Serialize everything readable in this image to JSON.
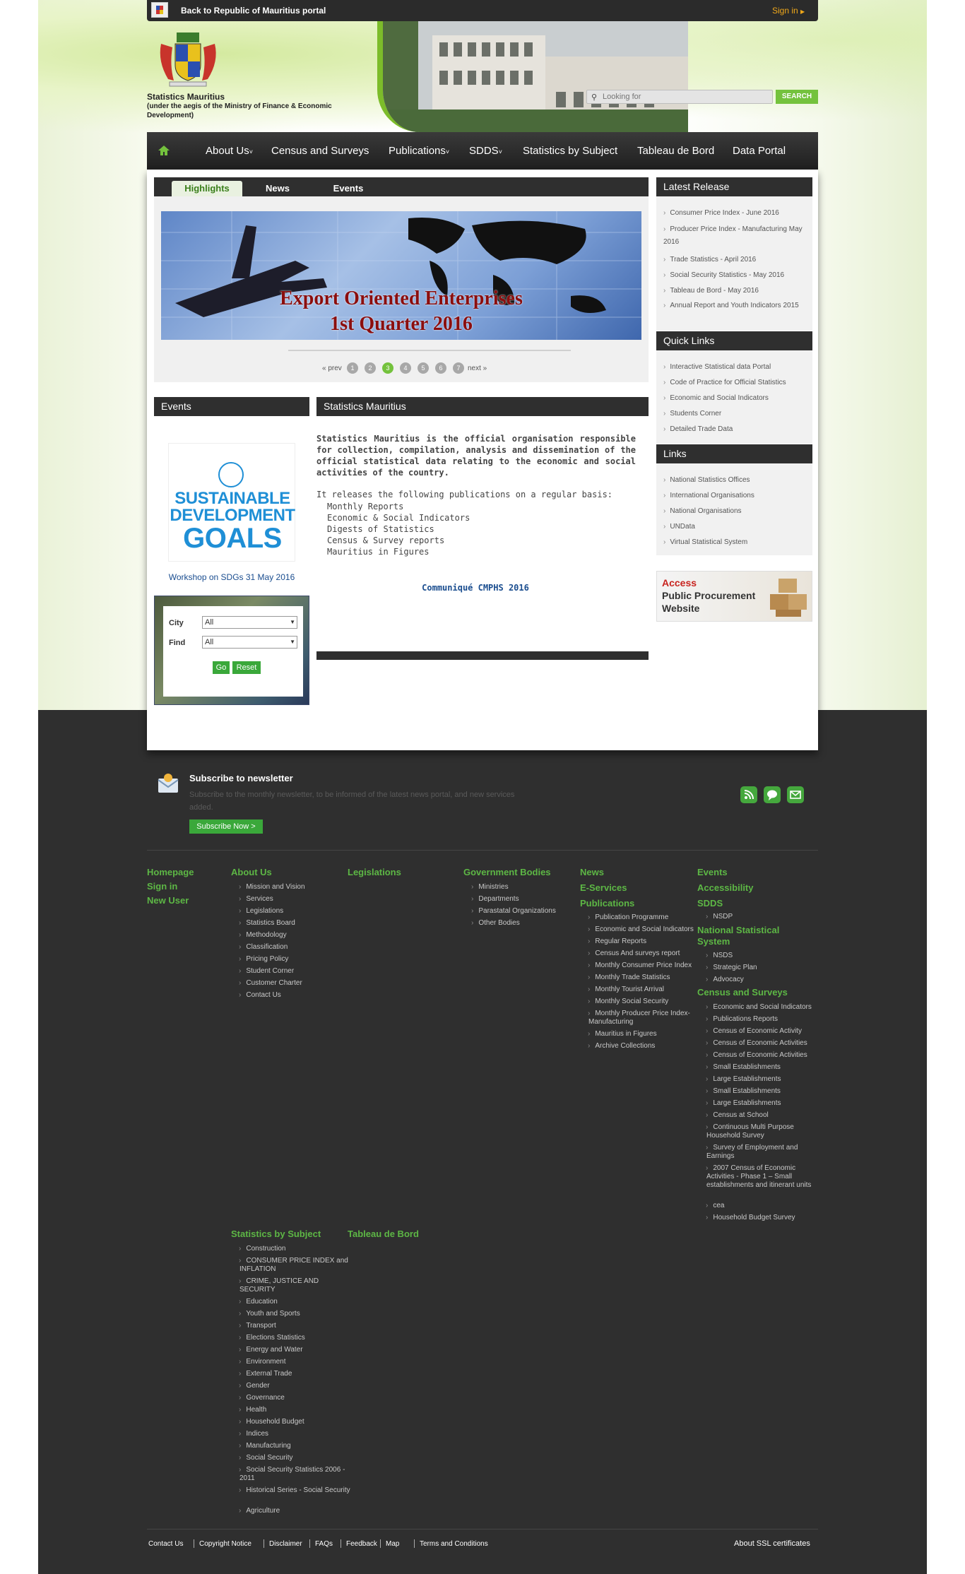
{
  "topbar": {
    "back_link": "Back to Republic of Mauritius portal",
    "signin": "Sign in"
  },
  "header": {
    "org_name": "Statistics Mauritius",
    "org_sub": "(under the aegis of the Ministry of Finance & Economic Development)",
    "search_placeholder": "Looking for",
    "search_button": "SEARCH"
  },
  "nav": [
    "About Us",
    "Census and Surveys",
    "Publications",
    "SDDS",
    "Statistics by Subject",
    "Tableau de Bord",
    "Data Portal"
  ],
  "tabs": {
    "highlights": "Highlights",
    "news": "News",
    "events": "Events"
  },
  "banner": {
    "line1": "Export Oriented Enterprises",
    "line2": "1st Quarter 2016"
  },
  "pager": {
    "prev": "« prev",
    "next": "next »",
    "pages": [
      "1",
      "2",
      "3",
      "4",
      "5",
      "6",
      "7"
    ],
    "current": "3"
  },
  "events_panel": {
    "title": "Events",
    "sdg_line1": "SUSTAINABLE",
    "sdg_line2": "DEVELOPMENT",
    "sdg_line3": "GOALS",
    "caption": "Workshop on SDGs 31 May 2016"
  },
  "finder": {
    "city_label": "City",
    "find_label": "Find",
    "city_value": "All",
    "find_value": "All",
    "go": "Go",
    "reset": "Reset"
  },
  "about": {
    "title": "Statistics Mauritius",
    "bold_lead": "Statistics Mauritius",
    "intro": "is the official organisation responsible for collection, compilation, analysis and dissemination of the official statistical data relating to the economic and social activities of the country.",
    "pubs_intro": "It releases the following publications on a regular basis:",
    "pubs": [
      "Monthly Reports",
      "Economic & Social Indicators",
      "Digests of Statistics",
      "Census & Survey reports",
      "Mauritius in Figures"
    ],
    "communique": "Communiqué CMPHS 2016"
  },
  "latest": {
    "title": "Latest Release",
    "items": [
      "Consumer Price Index - June 2016",
      "Producer Price Index - Manufacturing May 2016",
      "Trade Statistics - April 2016",
      "Social Security Statistics - May 2016",
      "Tableau de Bord - May 2016",
      "Annual Report and Youth Indicators 2015"
    ]
  },
  "quick": {
    "title": "Quick Links",
    "items": [
      "Interactive Statistical data Portal",
      "Code of Practice for Official Statistics",
      "Economic and Social Indicators",
      "Students Corner",
      "Detailed Trade Data"
    ]
  },
  "links": {
    "title": "Links",
    "items": [
      "National Statistics Offices",
      "International Organisations",
      "National Organisations",
      "UNData",
      "Virtual Statistical System"
    ]
  },
  "procurement": {
    "word1": "Access",
    "word2": "Public Procurement",
    "word3": "Website"
  },
  "newsletter": {
    "title": "Subscribe to newsletter",
    "text": "Subscribe to the monthly newsletter, to be informed of the latest news portal, and new services added.",
    "button": "Subscribe Now >"
  },
  "footer": {
    "col1": [
      "Homepage",
      "Sign in",
      "New User"
    ],
    "about_h": "About Us",
    "about": [
      "Mission and Vision",
      "Services",
      "Legislations",
      "Statistics Board",
      "Methodology",
      "Classification",
      "Pricing Policy",
      "Student Corner",
      "Customer Charter",
      "Contact Us"
    ],
    "legis_h": "Legislations",
    "gov_h": "Government Bodies",
    "gov": [
      "Ministries",
      "Departments",
      "Parastatal Organizations",
      "Other Bodies"
    ],
    "news_h": "News",
    "eserv_h": "E-Services",
    "pubs_h": "Publications",
    "pubs": [
      "Publication Programme",
      "Economic and Social Indicators",
      "Regular Reports",
      "Census And surveys report",
      "Monthly Consumer Price Index",
      "Monthly Trade Statistics",
      "Monthly Tourist Arrival",
      "Monthly Social Security",
      "Monthly Producer Price Index-Manufacturing",
      "Mauritius in Figures",
      "Archive Collections"
    ],
    "events_h": "Events",
    "access_h": "Accessibility",
    "sdds_h": "SDDS",
    "sdds": [
      "NSDP"
    ],
    "nss_h": "National Statistical System",
    "nss": [
      "NSDS",
      "Strategic Plan",
      "Advocacy"
    ],
    "census_h": "Census and Surveys",
    "census": [
      "Economic and Social Indicators",
      "Publications Reports",
      "Census of Economic Activity",
      "Census of Economic Activities",
      "Census of Economic Activities",
      "Small Establishments",
      "Large Establishments",
      "Small Establishments",
      "Large Establishments",
      "Census at School",
      "Continuous Multi Purpose Household Survey",
      "Survey of Employment and Earnings",
      "2007 Census of Economic Activities - Phase 1 – Small establishments and itinerant units",
      "cea",
      "Household Budget Survey"
    ],
    "subj_h": "Statistics by Subject",
    "subj": [
      "Construction",
      "CONSUMER PRICE INDEX and INFLATION",
      "CRIME, JUSTICE AND SECURITY",
      "Education",
      "Youth and Sports",
      "Transport",
      "Elections Statistics",
      "Energy and Water",
      "Environment",
      "External Trade",
      "Gender",
      "Governance",
      "Health",
      "Household Budget",
      "Indices",
      "Manufacturing",
      "Social Security",
      "Social Security Statistics 2006 - 2011",
      "Historical Series - Social Security",
      "Agriculture"
    ],
    "tdb_h": "Tableau de Bord",
    "bottom": [
      "Contact Us",
      "Copyright Notice",
      "Disclaimer",
      "FAQs",
      "Feedback",
      "Map",
      "Terms and Conditions"
    ],
    "ssl": "About SSL certificates"
  },
  "colors": {
    "accent": "#5db745",
    "dark": "#2f2f2f",
    "banner_text": "#8b0e0e",
    "link_blue": "#1a4d8f"
  }
}
